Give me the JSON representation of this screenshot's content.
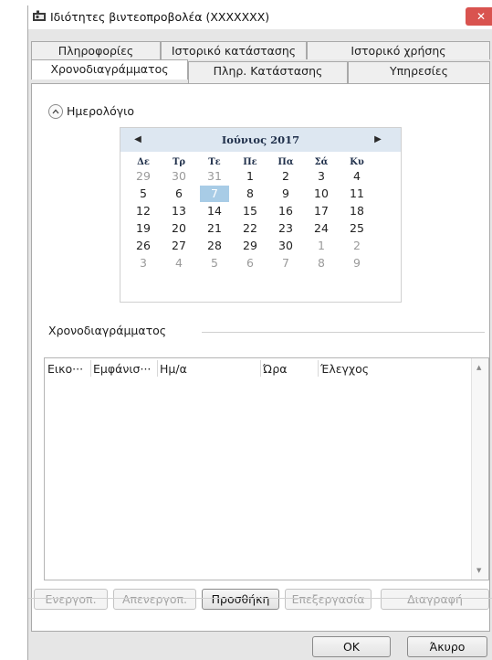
{
  "window": {
    "title": "Ιδιότητες βιντεοπροβολέα (XXXXXXX)",
    "close_glyph": "✕"
  },
  "tabs": {
    "row1": [
      {
        "label": "Πληροφορίες"
      },
      {
        "label": "Ιστορικό κατάστασης"
      },
      {
        "label": "Ιστορικό χρήσης"
      }
    ],
    "row2": [
      {
        "label": "Χρονοδιαγράμματος",
        "active": true
      },
      {
        "label": "Πληρ. Κατάστασης"
      },
      {
        "label": "Υπηρεσίες"
      }
    ]
  },
  "calendar_section": {
    "label": "Ημερολόγιο",
    "collapse_icon": "chevron-up-icon"
  },
  "calendar": {
    "prev": "◀",
    "next": "▶",
    "month_label": "Ιούνιος 2017",
    "weekdays": [
      "Δε",
      "Τρ",
      "Τε",
      "Πε",
      "Πα",
      "Σά",
      "Κυ"
    ],
    "weeks": [
      [
        "29",
        "30",
        "31",
        "1",
        "2",
        "3",
        "4"
      ],
      [
        "5",
        "6",
        "7",
        "8",
        "9",
        "10",
        "11"
      ],
      [
        "12",
        "13",
        "14",
        "15",
        "16",
        "17",
        "18"
      ],
      [
        "19",
        "20",
        "21",
        "22",
        "23",
        "24",
        "25"
      ],
      [
        "26",
        "27",
        "28",
        "29",
        "30",
        "1",
        "2"
      ],
      [
        "3",
        "4",
        "5",
        "6",
        "7",
        "8",
        "9"
      ]
    ],
    "selected_day": "7"
  },
  "schedule": {
    "group_label": "Χρονοδιαγράμματος",
    "columns": [
      "Εικο···",
      "Εμφάνισ···",
      "Ημ/α",
      "Ώρα",
      "Έλεγχος"
    ],
    "rows": []
  },
  "actions": [
    {
      "label": "Ενεργοπ.",
      "enabled": false
    },
    {
      "label": "Απενεργοπ.",
      "enabled": false
    },
    {
      "label": "Προσθήκη",
      "enabled": true
    },
    {
      "label": "Επεξεργασία",
      "enabled": false
    },
    {
      "label": "Διαγραφή",
      "enabled": false
    }
  ],
  "footer": {
    "ok_label": "OK",
    "cancel_label": "Άκυρο"
  }
}
